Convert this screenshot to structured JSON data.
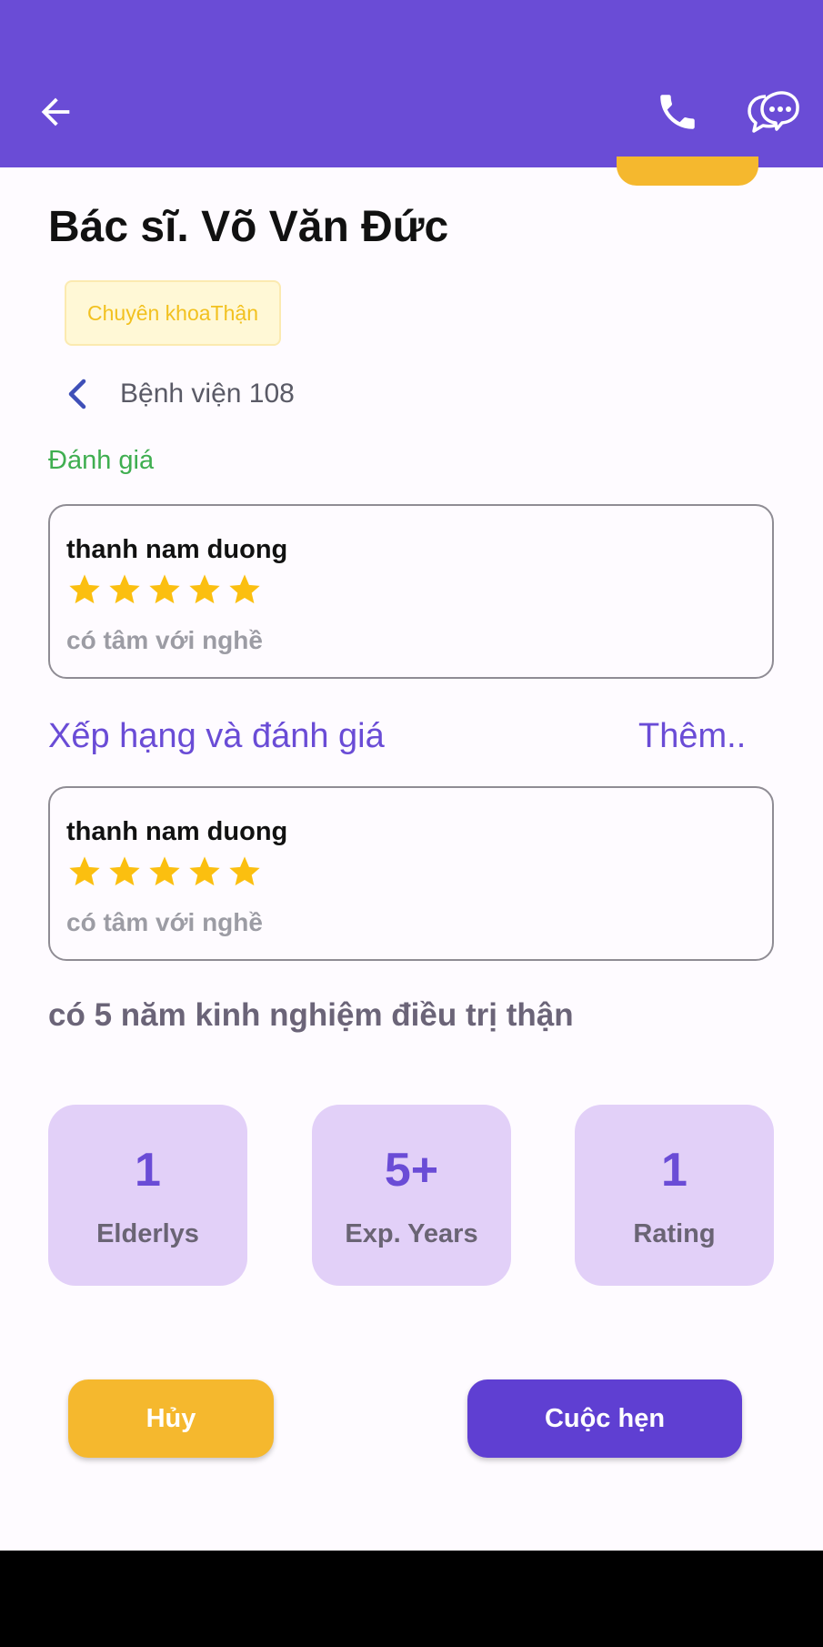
{
  "doctor": {
    "name": "Bác sĩ. Võ Văn Đức",
    "specialty": "Chuyên khoaThận",
    "hospital": "Bệnh viện 108"
  },
  "reviews_section": {
    "title": "Đánh giá"
  },
  "reviews": [
    {
      "user": "thanh nam duong",
      "stars": 5,
      "comment": "có tâm với nghề"
    },
    {
      "user": "thanh nam duong",
      "stars": 5,
      "comment": "có tâm với nghề"
    }
  ],
  "ratings_header": {
    "title": "Xếp hạng và đánh giá",
    "more": "Thêm.."
  },
  "experience_text": "có 5 năm kinh nghiệm điều trị thận",
  "stats": [
    {
      "value": "1",
      "label": "Elderlys"
    },
    {
      "value": "5+",
      "label": "Exp. Years"
    },
    {
      "value": "1",
      "label": "Rating"
    }
  ],
  "buttons": {
    "cancel": "Hủy",
    "appointment": "Cuộc hẹn"
  },
  "colors": {
    "primary": "#6a4cd6",
    "accent": "#f5b82e",
    "star": "#fbbf10",
    "stat_bg": "#e2d0f8"
  },
  "icons": {
    "back": "arrow-left-icon",
    "call": "phone-icon",
    "chat": "chat-bubbles-icon",
    "hospital_nav": "chevron-left-icon"
  }
}
